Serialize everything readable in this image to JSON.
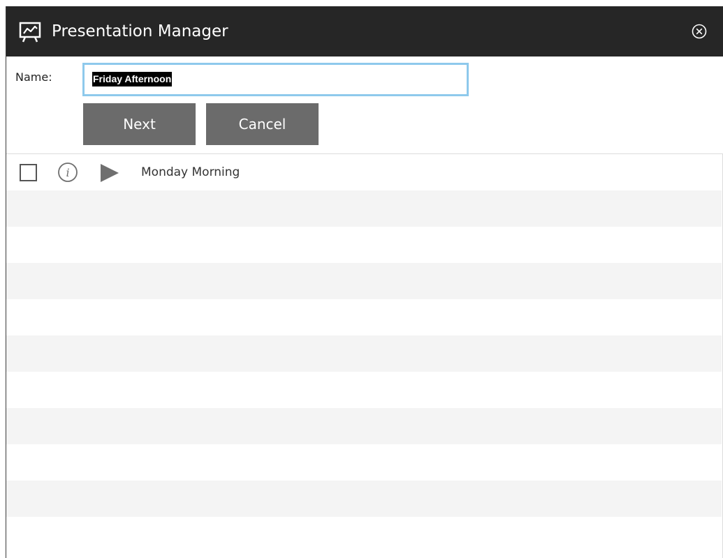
{
  "window": {
    "title": "Presentation Manager",
    "icon": "presentation-board-icon",
    "close_icon": "close-circle-icon"
  },
  "form": {
    "name_label": "Name:",
    "name_value": "Friday Afternoon"
  },
  "buttons": {
    "next_label": "Next",
    "cancel_label": "Cancel"
  },
  "presentations": [
    {
      "name": "Monday Morning",
      "checked": false,
      "info_icon": "info-icon",
      "play_icon": "play-icon"
    }
  ],
  "colors": {
    "titlebar": "#262626",
    "button": "#6b6b6b",
    "input_focus_border": "#8ec9ec",
    "row_stripe": "#f4f4f4"
  }
}
